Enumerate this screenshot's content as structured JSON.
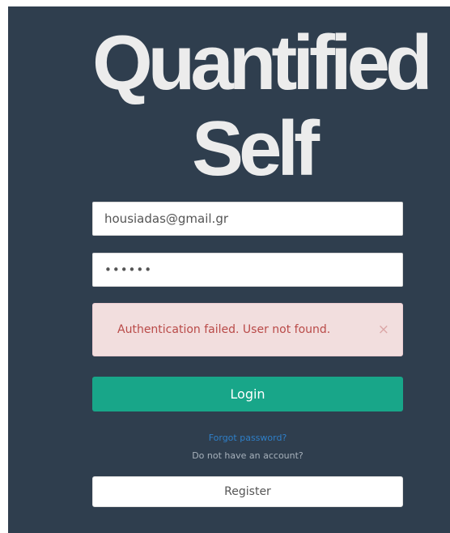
{
  "logo": {
    "line1": "Quantified",
    "line2": "Self"
  },
  "form": {
    "email_value": "housiadas@gmail.gr",
    "password_value": "••••••"
  },
  "alert": {
    "message": "Authentication failed. User not found.",
    "close_icon": "×"
  },
  "buttons": {
    "login_label": "Login",
    "register_label": "Register"
  },
  "links": {
    "forgot_password": "Forgot password?",
    "no_account": "Do not have an account?"
  },
  "colors": {
    "background": "#2f3e4e",
    "accent": "#18a689",
    "alert_bg": "#f2dede",
    "alert_text": "#b94a48",
    "link": "#2f7fc8"
  }
}
